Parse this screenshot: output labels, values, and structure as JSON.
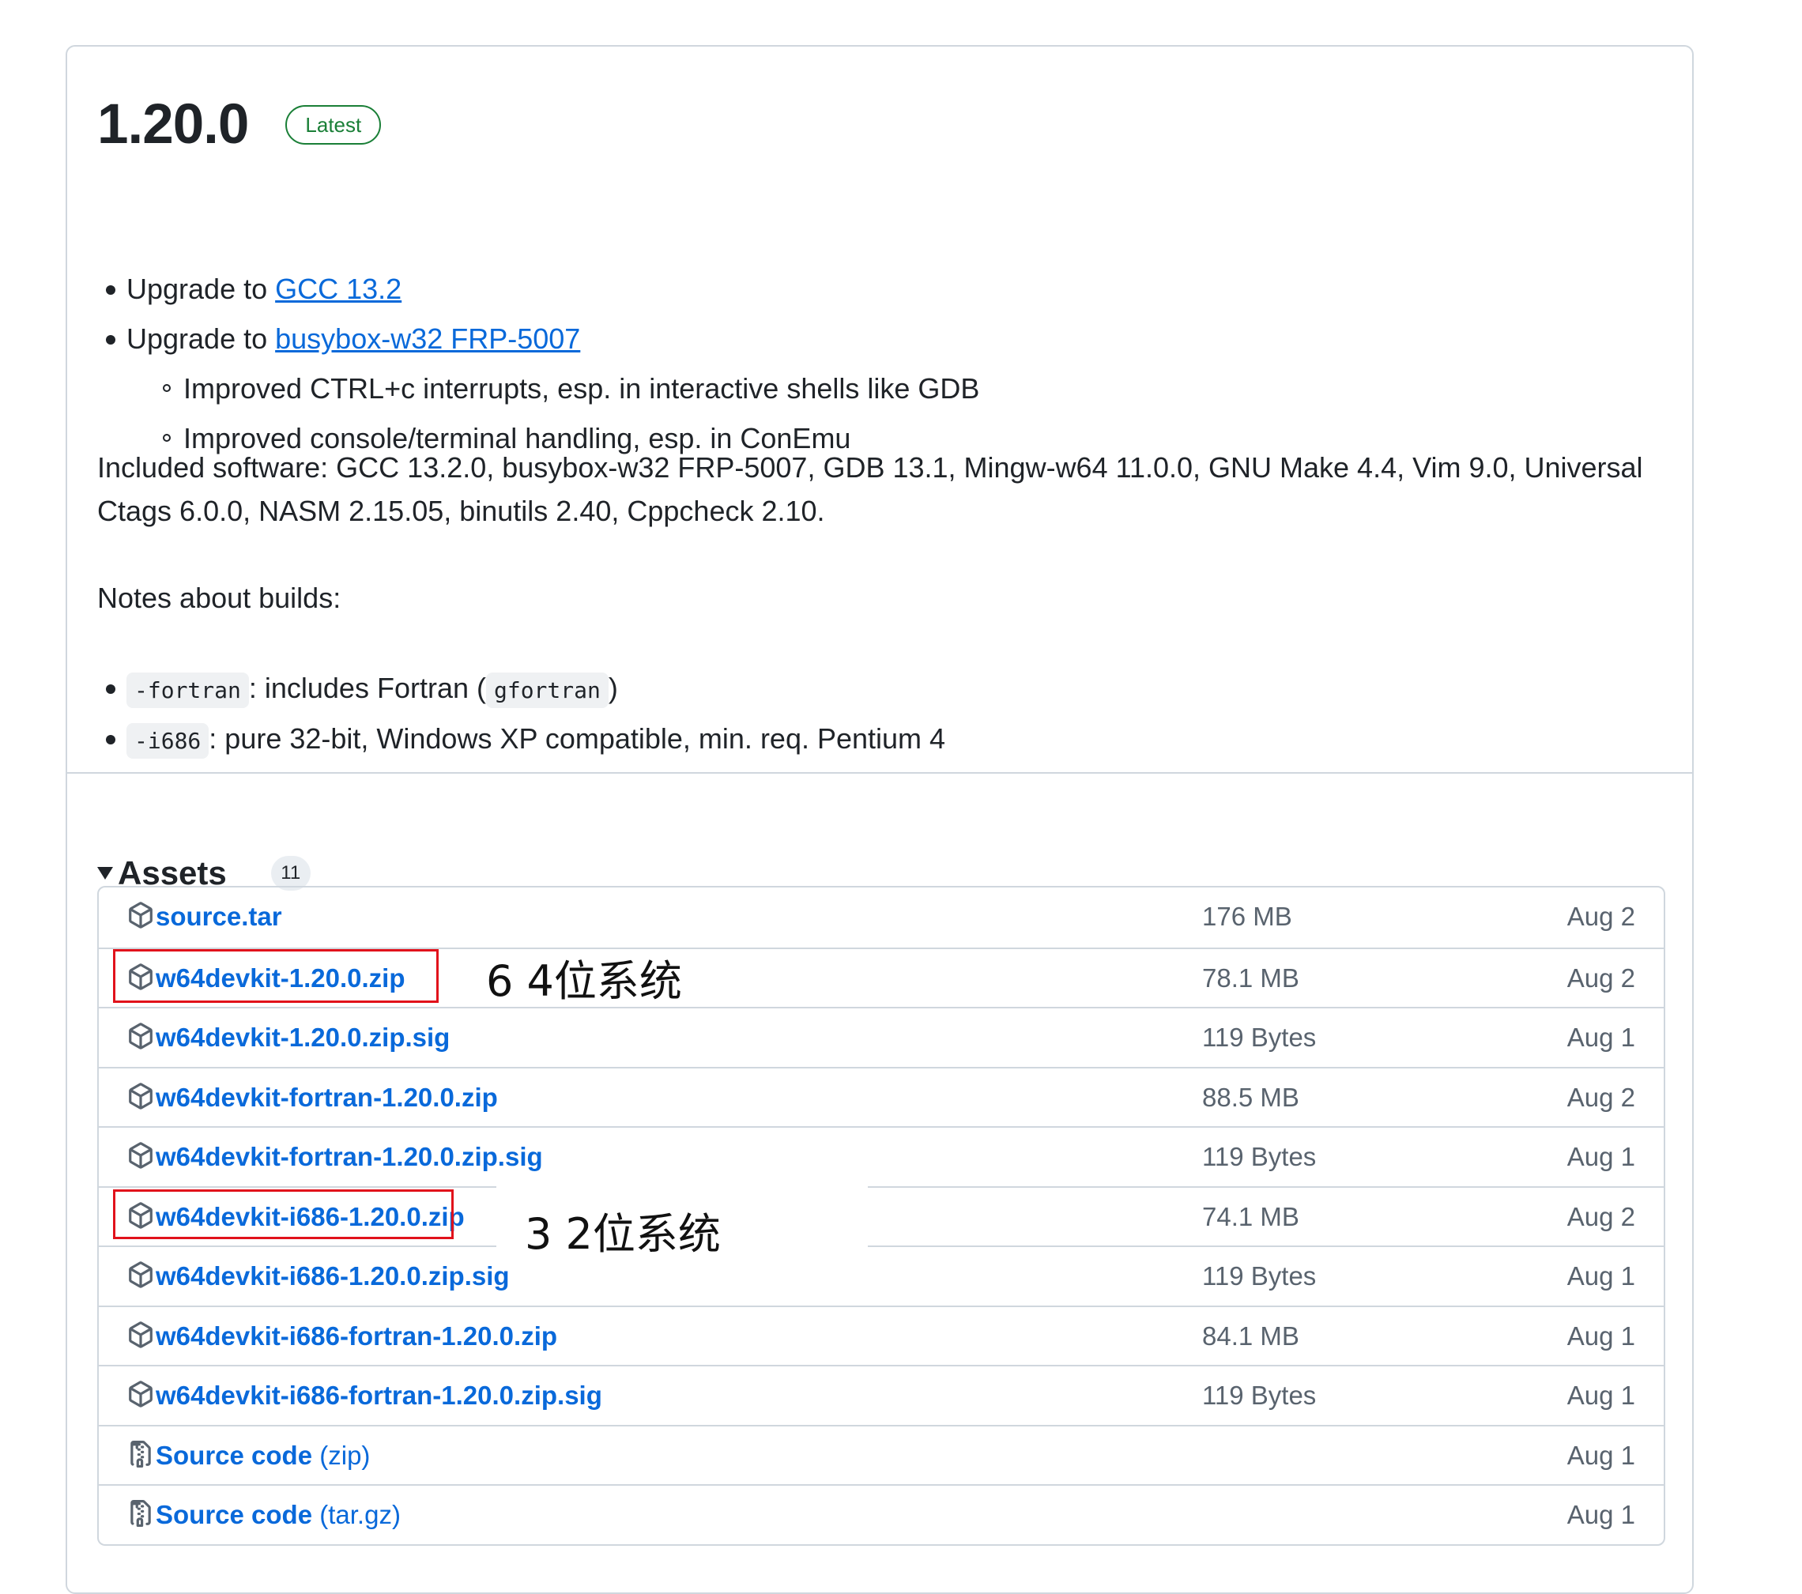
{
  "release": {
    "version": "1.20.0",
    "badge": "Latest"
  },
  "notes": {
    "items": [
      {
        "prefix": "Upgrade to ",
        "link": "GCC 13.2"
      },
      {
        "prefix": "Upgrade to ",
        "link": "busybox-w32 FRP-5007"
      }
    ],
    "subitems": [
      "Improved CTRL+c interrupts, esp. in interactive shells like GDB",
      "Improved console/terminal handling, esp. in ConEmu"
    ],
    "included_line1": "Included software: GCC 13.2.0, busybox-w32 FRP-5007, GDB 13.1, Mingw-w64 11.0.0, GNU Make 4.4, Vim 9.0, Universal",
    "included_line2": "Ctags 6.0.0, NASM 2.15.05, binutils 2.40, Cppcheck 2.10.",
    "builds_heading": "Notes about builds:",
    "builds": [
      {
        "code": "-fortran",
        "text_before": ": includes Fortran (",
        "code2": "gfortran",
        "text_after": ")"
      },
      {
        "code": "-i686",
        "text": ": pure 32-bit, Windows XP compatible, min. req. Pentium 4"
      }
    ]
  },
  "assets": {
    "title": "Assets",
    "count": "11",
    "rows": [
      {
        "name": "source.tar",
        "suffix": "",
        "size": "176 MB",
        "date": "Aug 2",
        "icon": "package-icon"
      },
      {
        "name": "w64devkit-1.20.0.zip",
        "suffix": "",
        "size": "78.1 MB",
        "date": "Aug 2",
        "icon": "package-icon"
      },
      {
        "name": "w64devkit-1.20.0.zip.sig",
        "suffix": "",
        "size": "119 Bytes",
        "date": "Aug 1",
        "icon": "package-icon"
      },
      {
        "name": "w64devkit-fortran-1.20.0.zip",
        "suffix": "",
        "size": "88.5 MB",
        "date": "Aug 2",
        "icon": "package-icon"
      },
      {
        "name": "w64devkit-fortran-1.20.0.zip.sig",
        "suffix": "",
        "size": "119 Bytes",
        "date": "Aug 1",
        "icon": "package-icon"
      },
      {
        "name": "w64devkit-i686-1.20.0.zip",
        "suffix": "",
        "size": "74.1 MB",
        "date": "Aug 2",
        "icon": "package-icon"
      },
      {
        "name": "w64devkit-i686-1.20.0.zip.sig",
        "suffix": "",
        "size": "119 Bytes",
        "date": "Aug 1",
        "icon": "package-icon"
      },
      {
        "name": "w64devkit-i686-fortran-1.20.0.zip",
        "suffix": "",
        "size": "84.1 MB",
        "date": "Aug 1",
        "icon": "package-icon"
      },
      {
        "name": "w64devkit-i686-fortran-1.20.0.zip.sig",
        "suffix": "",
        "size": "119 Bytes",
        "date": "Aug 1",
        "icon": "package-icon"
      },
      {
        "name": "Source code",
        "suffix": " (zip)",
        "size": "",
        "date": "Aug 1",
        "icon": "file-zip-icon"
      },
      {
        "name": "Source code",
        "suffix": " (tar.gz)",
        "size": "",
        "date": "Aug 1",
        "icon": "file-zip-icon"
      }
    ]
  },
  "annotations": {
    "label_64": "6 4位系统",
    "label_32": "3 2位系统"
  },
  "colors": {
    "link": "#0969da",
    "badge_green": "#1a7f37",
    "border": "#d0d7de",
    "annotation_red": "#e1121b"
  }
}
